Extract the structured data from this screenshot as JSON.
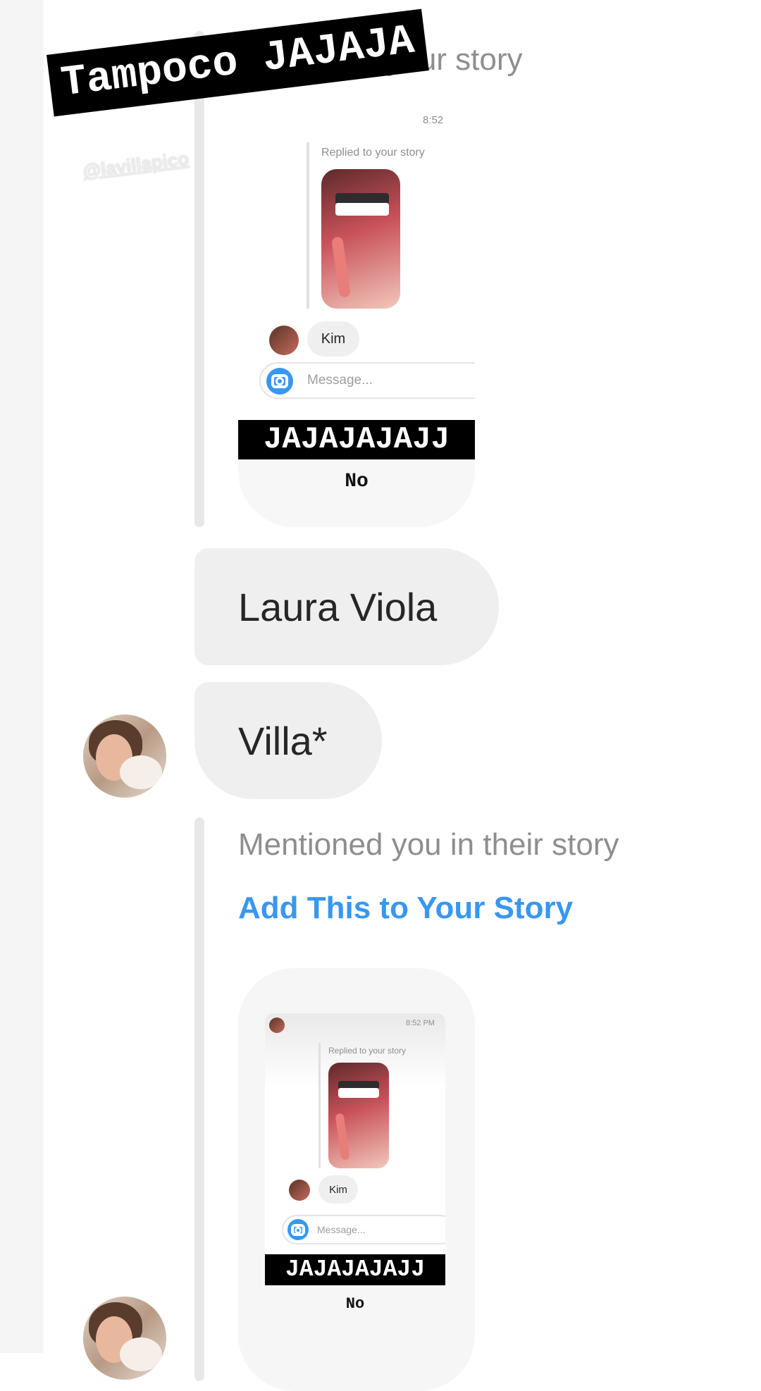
{
  "overlay": {
    "caption": "Tampoco JAJAJA",
    "mention": "@lavillapico"
  },
  "thread": {
    "top_reply_label": "Replied to your story",
    "messages": [
      {
        "text": "Laura Viola"
      },
      {
        "text": "Villa*"
      }
    ],
    "mention_label": "Mentioned you in their story",
    "add_to_story_link": "Add This to Your Story"
  },
  "story_card_1": {
    "time": "8:52",
    "replied_label": "Replied to your story",
    "reply_text": "Kim",
    "message_placeholder": "Message...",
    "banner_text": "JAJAJAJAJJ",
    "answer_text": "No"
  },
  "story_card_2": {
    "time": "8:52 PM",
    "replied_label": "Replied to your story",
    "reply_text": "Kim",
    "message_placeholder": "Message...",
    "banner_text": "JAJAJAJAJJ",
    "answer_text": "No"
  },
  "colors": {
    "link_blue": "#3897f0",
    "bubble_gray": "#efefef",
    "meta_gray": "#8e8e8e"
  },
  "icons": [
    "camera-icon",
    "avatar"
  ]
}
